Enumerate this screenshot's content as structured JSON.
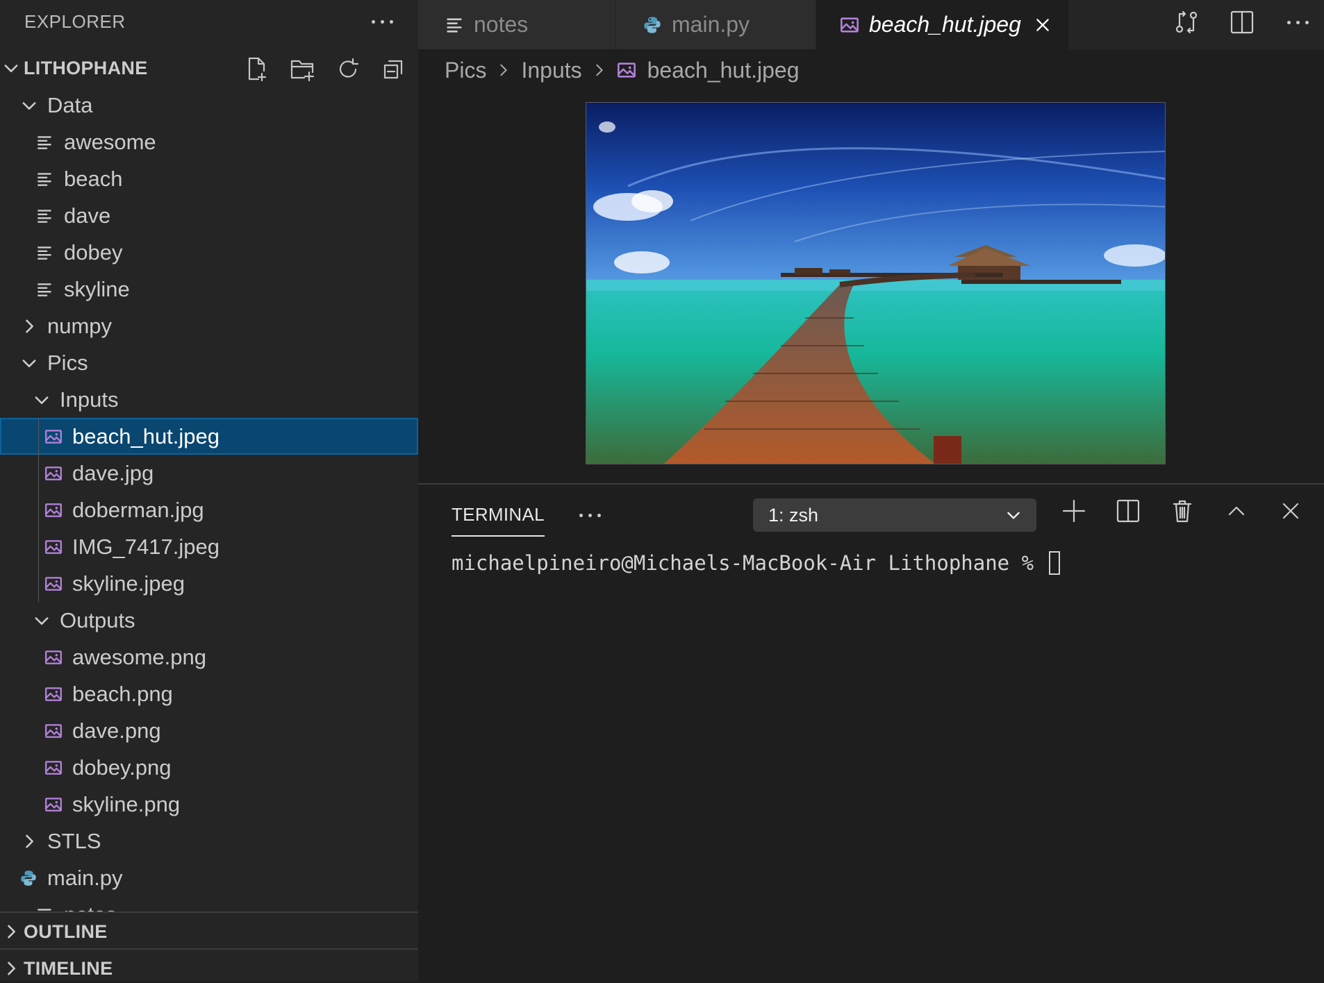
{
  "sidebar": {
    "title": "EXPLORER",
    "project": "LITHOPHANE",
    "tree": [
      {
        "label": "Data",
        "kind": "folder-open",
        "depth": 1
      },
      {
        "label": "awesome",
        "kind": "text",
        "depth": 2
      },
      {
        "label": "beach",
        "kind": "text",
        "depth": 2
      },
      {
        "label": "dave",
        "kind": "text",
        "depth": 2
      },
      {
        "label": "dobey",
        "kind": "text",
        "depth": 2
      },
      {
        "label": "skyline",
        "kind": "text",
        "depth": 2
      },
      {
        "label": "numpy",
        "kind": "folder-closed",
        "depth": 1
      },
      {
        "label": "Pics",
        "kind": "folder-open",
        "depth": 1
      },
      {
        "label": "Inputs",
        "kind": "folder-open",
        "depth": 2
      },
      {
        "label": "beach_hut.jpeg",
        "kind": "image",
        "depth": 3,
        "selected": true
      },
      {
        "label": "dave.jpg",
        "kind": "image",
        "depth": 3
      },
      {
        "label": "doberman.jpg",
        "kind": "image",
        "depth": 3
      },
      {
        "label": "IMG_7417.jpeg",
        "kind": "image",
        "depth": 3
      },
      {
        "label": "skyline.jpeg",
        "kind": "image",
        "depth": 3
      },
      {
        "label": "Outputs",
        "kind": "folder-open",
        "depth": 2
      },
      {
        "label": "awesome.png",
        "kind": "image",
        "depth": 3
      },
      {
        "label": "beach.png",
        "kind": "image",
        "depth": 3
      },
      {
        "label": "dave.png",
        "kind": "image",
        "depth": 3
      },
      {
        "label": "dobey.png",
        "kind": "image",
        "depth": 3
      },
      {
        "label": "skyline.png",
        "kind": "image",
        "depth": 3
      },
      {
        "label": "STLS",
        "kind": "folder-closed",
        "depth": 1
      },
      {
        "label": "main.py",
        "kind": "python",
        "depth": 1
      },
      {
        "label": "notes",
        "kind": "text",
        "depth": 1
      }
    ],
    "outline_label": "OUTLINE",
    "timeline_label": "TIMELINE"
  },
  "tabs": [
    {
      "label": "notes",
      "icon": "text-file-icon",
      "active": false
    },
    {
      "label": "main.py",
      "icon": "python-icon",
      "active": false
    },
    {
      "label": "beach_hut.jpeg",
      "icon": "image-file-icon",
      "active": true
    }
  ],
  "breadcrumb": [
    "Pics",
    "Inputs",
    "beach_hut.jpeg"
  ],
  "panel": {
    "tab_label": "TERMINAL",
    "terminal_select": "1: zsh",
    "prompt": "michaelpineiro@Michaels-MacBook-Air Lithophane % "
  },
  "colors": {
    "selection": "#094771",
    "image_icon": "#b180d7",
    "python_icon": "#519aba"
  }
}
